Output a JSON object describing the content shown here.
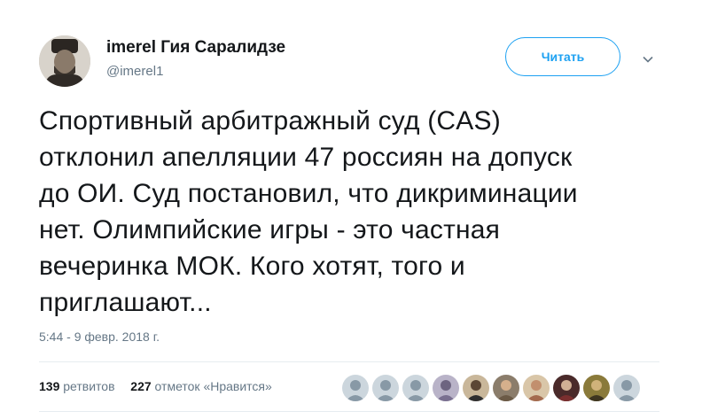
{
  "author": {
    "display_name": "imerel Гия Саралидзе",
    "handle": "@imerel1",
    "avatar_icon": "profile-photo-man-in-hat"
  },
  "follow_button": {
    "label": "Читать"
  },
  "caret_icon": "chevron-down-icon",
  "tweet": {
    "lines": [
      "Спортивный арбитражный суд (CAS)",
      "отклонил апелляции 47 россиян на допуск",
      "до ОИ. Суд постановил, что дикриминации",
      "нет. Олимпийские игры - это частная",
      "вечеринка МОК. Кого хотят, того и",
      "приглашают..."
    ]
  },
  "timestamp": "5:44 - 9 февр. 2018 г.",
  "stats": {
    "retweets_count": "139",
    "retweets_label": "ретвитов",
    "likes_count": "227",
    "likes_label": "отметок «Нравится»"
  },
  "likers": [
    {
      "icon": "default-avatar-icon"
    },
    {
      "icon": "default-avatar-icon"
    },
    {
      "icon": "default-avatar-icon"
    },
    {
      "icon": "user-photo-avatar"
    },
    {
      "icon": "user-photo-avatar"
    },
    {
      "icon": "user-photo-avatar"
    },
    {
      "icon": "user-photo-avatar"
    },
    {
      "icon": "user-photo-avatar"
    },
    {
      "icon": "user-photo-avatar"
    },
    {
      "icon": "default-avatar-icon"
    }
  ],
  "colors": {
    "accent": "#1da1f2",
    "text": "#14171a",
    "secondary_text": "#657786",
    "divider": "#e6ecf0"
  }
}
